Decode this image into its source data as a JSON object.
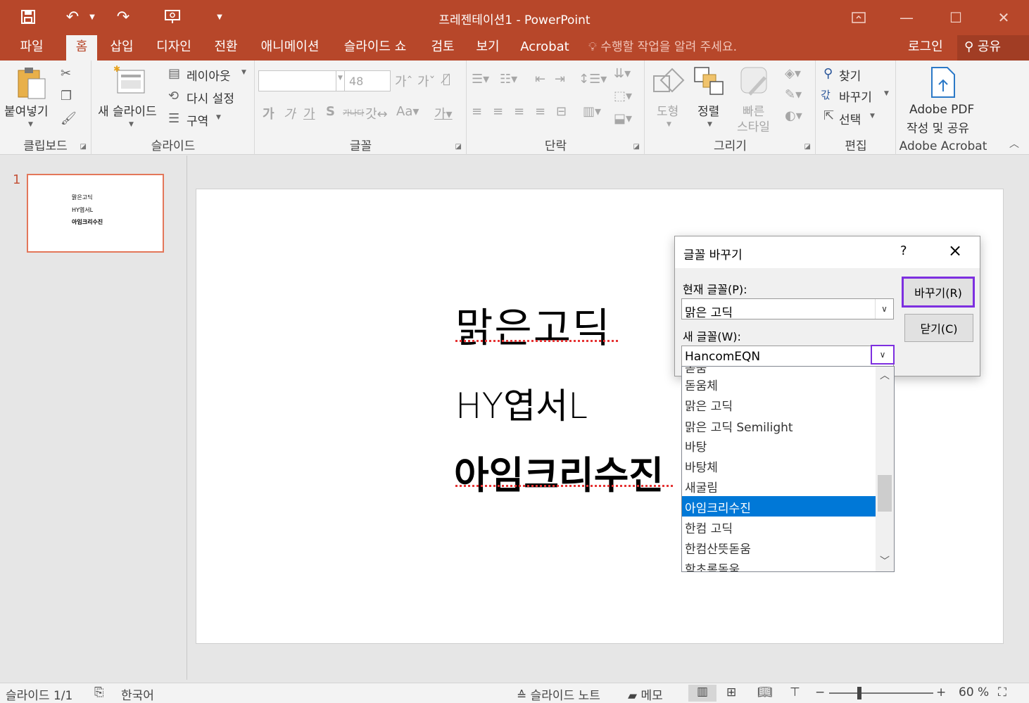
{
  "title_bar": {
    "title": "프레젠테이션1 - PowerPoint"
  },
  "tabs": [
    {
      "label": "파일",
      "active": false
    },
    {
      "label": "홈",
      "active": true
    },
    {
      "label": "삽입",
      "active": false
    },
    {
      "label": "디자인",
      "active": false
    },
    {
      "label": "전환",
      "active": false
    },
    {
      "label": "애니메이션",
      "active": false
    },
    {
      "label": "슬라이드 쇼",
      "active": false
    },
    {
      "label": "검토",
      "active": false
    },
    {
      "label": "보기",
      "active": false
    },
    {
      "label": "Acrobat",
      "active": false
    }
  ],
  "tell_me": "수행할 작업을 알려 주세요.",
  "account": {
    "login": "로그인",
    "share": "공유"
  },
  "ribbon": {
    "clipboard": {
      "paste": "붙여넣기",
      "label": "클립보드"
    },
    "slides": {
      "new_slide": "새 슬라이드",
      "layout": "레이아웃",
      "reset": "다시 설정",
      "section": "구역",
      "label": "슬라이드"
    },
    "font": {
      "font_name": "",
      "font_size": "48",
      "label": "글꼴"
    },
    "paragraph": {
      "label": "단락"
    },
    "drawing": {
      "shapes": "도형",
      "arrange": "정렬",
      "quick_styles_1": "빠른",
      "quick_styles_2": "스타일",
      "label": "그리기"
    },
    "editing": {
      "find": "찾기",
      "replace": "바꾸기",
      "select": "선택",
      "label": "편집"
    },
    "acrobat": {
      "create_1": "Adobe PDF",
      "create_2": "작성 및 공유",
      "label": "Adobe Acrobat"
    }
  },
  "thumbnail": {
    "number": "1",
    "lines": [
      "맑은고딕",
      "HY엽서L",
      "아임크리수진"
    ]
  },
  "slide": {
    "lines": [
      "맑은고딕",
      "HY엽서L",
      "아임크리수진"
    ]
  },
  "dialog": {
    "title": "글꼴 바꾸기",
    "help": "?",
    "current_font_label": "현재 글꼴(P):",
    "current_font_value": "맑은 고딕",
    "new_font_label": "새 글꼴(W):",
    "new_font_value": "HancomEQN",
    "replace_button": "바꾸기(R)",
    "close_button": "닫기(C)"
  },
  "font_list": {
    "items": [
      "돋움",
      "돋움체",
      "맑은 고딕",
      "맑은 고딕 Semilight",
      "바탕",
      "바탕체",
      "새굴림",
      "아임크리수진",
      "한컴 고딕",
      "한컴산뜻돋움",
      "함초롬돋움"
    ],
    "selected": "아임크리수진"
  },
  "status_bar": {
    "slide_info": "슬라이드 1/1",
    "language": "한국어",
    "notes": "슬라이드 노트",
    "comments": "메모",
    "zoom": "60 %"
  },
  "colors": {
    "accent": "#b7472a",
    "selection": "#0078d7",
    "highlight_border": "#7d2fe0"
  }
}
